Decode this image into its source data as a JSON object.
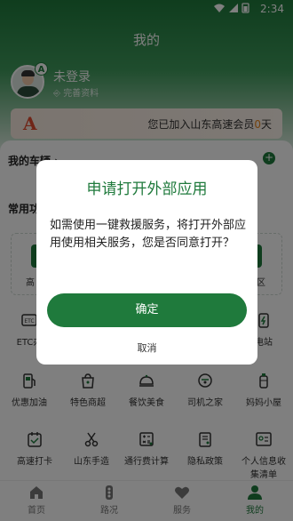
{
  "status_bar": {
    "time": "2:34",
    "icons": [
      "wifi-icon",
      "signal-icon",
      "battery-icon"
    ]
  },
  "header": {
    "title": "我的"
  },
  "profile": {
    "login_status": "未登录",
    "complete_profile": "完善资料",
    "badge": "A"
  },
  "membership": {
    "logo": "A",
    "prefix": "您已加入山东高速会员",
    "days": "0",
    "suffix": "天"
  },
  "vehicles": {
    "title": "我的车辆",
    "chevron": "›"
  },
  "common_services": {
    "title": "常用功",
    "items": [
      {
        "label": "高"
      },
      {
        "label": "区"
      }
    ]
  },
  "grid": {
    "row1": [
      {
        "label": "ETC办",
        "icon": "etc-icon"
      },
      {
        "label": "电站",
        "icon": "charging-icon"
      }
    ],
    "row2": [
      {
        "label": "优惠加油",
        "icon": "fuel-icon"
      },
      {
        "label": "特色商超",
        "icon": "shop-icon"
      },
      {
        "label": "餐饮美食",
        "icon": "food-icon"
      },
      {
        "label": "司机之家",
        "icon": "driver-home-icon"
      },
      {
        "label": "妈妈小屋",
        "icon": "mom-room-icon"
      }
    ],
    "row3": [
      {
        "label": "高速打卡",
        "icon": "checkin-icon"
      },
      {
        "label": "山东手造",
        "icon": "craft-icon"
      },
      {
        "label": "通行费计算",
        "icon": "toll-calculator-icon"
      },
      {
        "label": "隐私政策",
        "icon": "privacy-icon"
      },
      {
        "label": "个人信息收",
        "label2": "集清单",
        "icon": "info-list-icon"
      }
    ]
  },
  "bottom_nav": [
    {
      "label": "首页",
      "icon": "home-icon"
    },
    {
      "label": "路况",
      "icon": "traffic-icon"
    },
    {
      "label": "服务",
      "icon": "heart-icon"
    },
    {
      "label": "我的",
      "icon": "person-icon",
      "active": true
    }
  ],
  "dialog": {
    "title": "申请打开外部应用",
    "message": "如需使用一键救援服务，将打开外部应用使用相关服务，您是否同意打开？",
    "confirm_label": "确定",
    "cancel_label": "取消"
  },
  "colors": {
    "brand_green": "#1f7a3c",
    "accent_orange": "#e8841a",
    "logo_red": "#e04a2f"
  }
}
